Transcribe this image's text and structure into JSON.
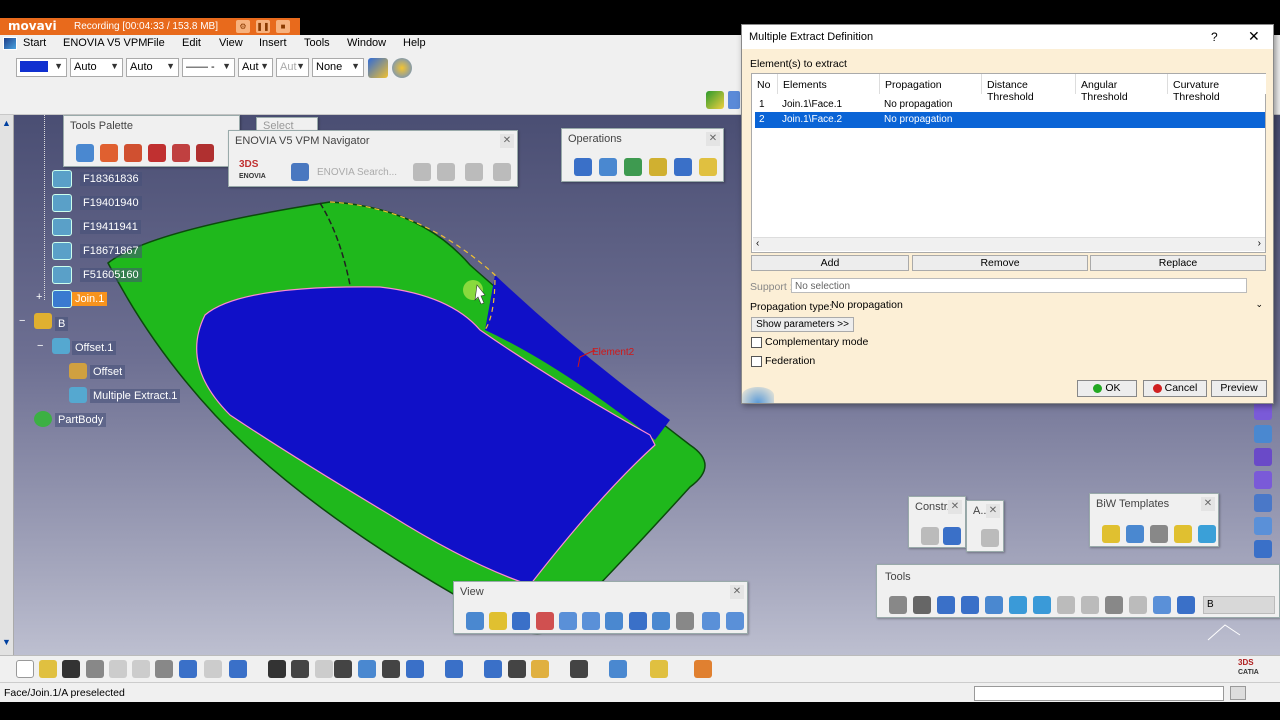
{
  "recorder": {
    "logo": "movavi",
    "status": "Recording   [00:04:33 / 153.8 MB]"
  },
  "menu": {
    "items": [
      "Start",
      "ENOVIA V5 VPM",
      "File",
      "Edit",
      "View",
      "Insert",
      "Tools",
      "Window",
      "Help"
    ]
  },
  "toolbar": {
    "color_value": "",
    "line_weight": "Auto",
    "line_type": "Auto",
    "line_style": "—— -",
    "layer_a": "Aut",
    "layer_b": "Aut",
    "filter": "None"
  },
  "tree": {
    "items": [
      {
        "label": "F18361836"
      },
      {
        "label": "F19401940"
      },
      {
        "label": "F19411941"
      },
      {
        "label": "F18671867"
      },
      {
        "label": "F51605160"
      }
    ],
    "join": "Join.1",
    "b": "B",
    "offset1": "Offset.1",
    "offset": "Offset",
    "multi_extract": "Multiple Extract.1",
    "partbody": "PartBody"
  },
  "palettes": {
    "tools_palette": "Tools Palette",
    "select": "Select",
    "enovia_nav": "ENOVIA V5 VPM Navigator",
    "enovia_search": "ENOVIA Search...",
    "operations": "Operations",
    "view": "View",
    "constr": "Constr...",
    "a": "A...",
    "biw": "BiW Templates",
    "tools": "Tools",
    "tools_field": "B"
  },
  "viewport": {
    "label": "Element2"
  },
  "dialog": {
    "title": "Multiple Extract Definition",
    "help": "?",
    "close": "✕",
    "section": "Element(s) to extract",
    "columns": [
      "No",
      "Elements",
      "Propagation",
      "Distance Threshold",
      "Angular Threshold",
      "Curvature Threshold"
    ],
    "rows": [
      {
        "no": "1",
        "element": "Join.1\\Face.1",
        "propagation": "No propagation"
      },
      {
        "no": "2",
        "element": "Join.1\\Face.2",
        "propagation": "No propagation"
      }
    ],
    "add": "Add",
    "remove": "Remove",
    "replace": "Replace",
    "support_label": "Support :",
    "support_value": "No selection",
    "prop_type_label": "Propagation type:",
    "prop_type_value": "No propagation",
    "show_params": "Show parameters >>",
    "complementary": "Complementary mode",
    "federation": "Federation",
    "ok": "OK",
    "cancel": "Cancel",
    "preview": "Preview"
  },
  "status": {
    "text": "Face/Join.1/A preselected"
  },
  "colors": {
    "part_green": "#1fb81c",
    "part_blue": "#1010c8",
    "selection": "#0a64d6",
    "dialog_bg": "#fcefd6"
  }
}
